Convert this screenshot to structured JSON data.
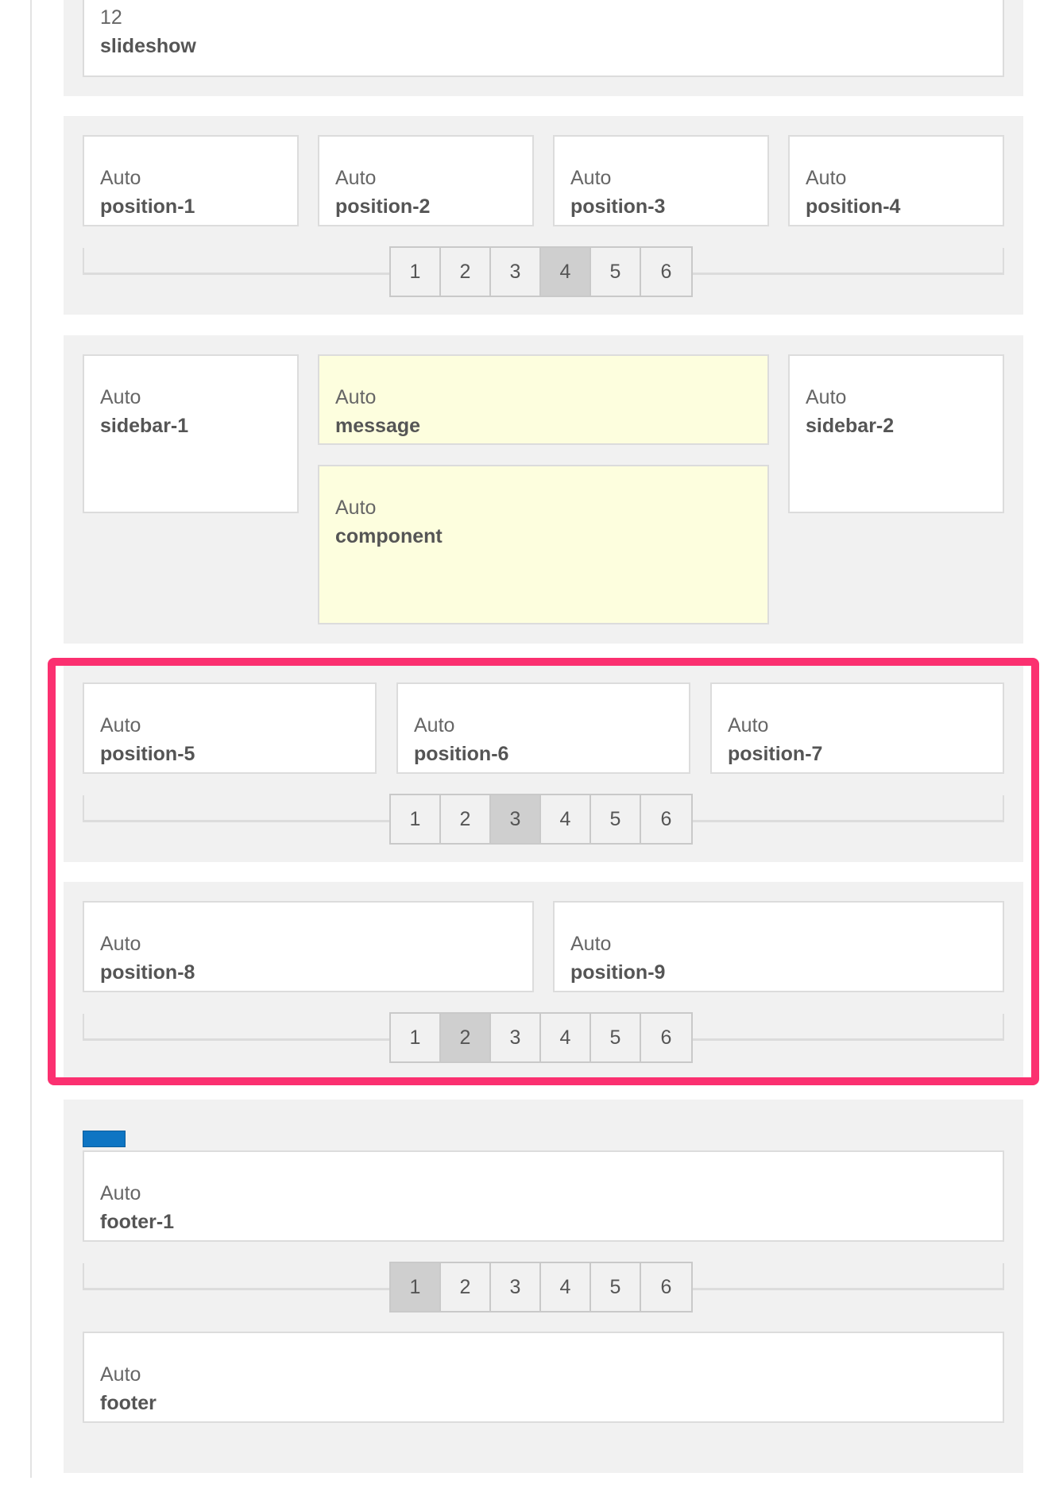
{
  "top": {
    "width": "12",
    "name": "slideshow"
  },
  "row_a": {
    "modules": [
      {
        "width": "Auto",
        "name": "position-1"
      },
      {
        "width": "Auto",
        "name": "position-2"
      },
      {
        "width": "Auto",
        "name": "position-3"
      },
      {
        "width": "Auto",
        "name": "position-4"
      }
    ],
    "pager": [
      "1",
      "2",
      "3",
      "4",
      "5",
      "6"
    ],
    "active": 4
  },
  "main": {
    "sidebar1": {
      "width": "Auto",
      "name": "sidebar-1"
    },
    "message": {
      "width": "Auto",
      "name": "message"
    },
    "component": {
      "width": "Auto",
      "name": "component"
    },
    "sidebar2": {
      "width": "Auto",
      "name": "sidebar-2"
    }
  },
  "row_b": {
    "modules": [
      {
        "width": "Auto",
        "name": "position-5"
      },
      {
        "width": "Auto",
        "name": "position-6"
      },
      {
        "width": "Auto",
        "name": "position-7"
      }
    ],
    "pager": [
      "1",
      "2",
      "3",
      "4",
      "5",
      "6"
    ],
    "active": 3
  },
  "row_c": {
    "modules": [
      {
        "width": "Auto",
        "name": "position-8"
      },
      {
        "width": "Auto",
        "name": "position-9"
      }
    ],
    "pager": [
      "1",
      "2",
      "3",
      "4",
      "5",
      "6"
    ],
    "active": 2
  },
  "footer_row": {
    "footer1": {
      "width": "Auto",
      "name": "footer-1"
    },
    "pager": [
      "1",
      "2",
      "3",
      "4",
      "5",
      "6"
    ],
    "active": 1,
    "footer": {
      "width": "Auto",
      "name": "footer"
    }
  },
  "colors": {
    "highlight": "#fb3070",
    "active_page": "#cfcfcf",
    "accent_bar": "#0e75c3",
    "yellow_module": "#fdfede"
  }
}
